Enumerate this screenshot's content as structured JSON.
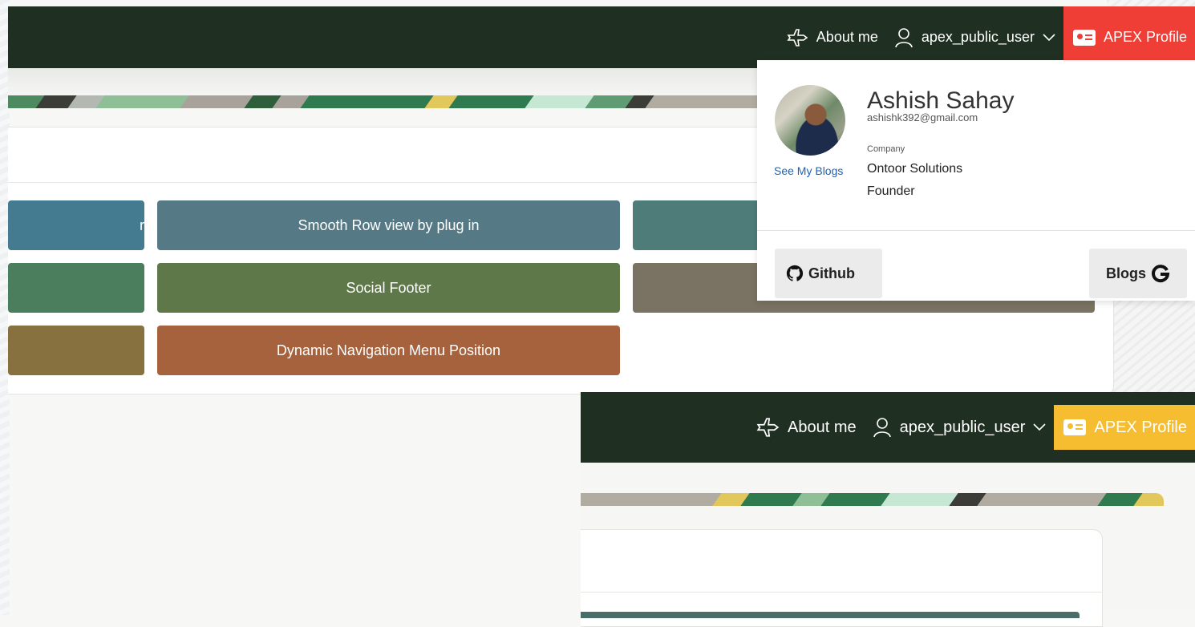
{
  "header": {
    "about_label": "About me",
    "user_label": "apex_public_user",
    "apex_profile_label": "APEX Profile",
    "apex_color_top": "#ef3e36",
    "apex_color_bottom": "#f5bd2f",
    "bar_color": "#1f2f22",
    "icons": {
      "about": "airplane-icon",
      "user": "user-icon",
      "chevron": "chevron-down-icon",
      "profile": "id-card-icon"
    }
  },
  "tiles": [
    {
      "label": "r",
      "color": "#447b90"
    },
    {
      "label": "Smooth Row view by plug in",
      "color": "#557a85"
    },
    {
      "label": "",
      "color": "#4e7d79"
    },
    {
      "label": "",
      "color": "#4b7e5c"
    },
    {
      "label": "Social Footer",
      "color": "#5f784a"
    },
    {
      "label": "",
      "color": "#7a7363"
    },
    {
      "label": "",
      "color": "#87713e"
    },
    {
      "label": "Dynamic Navigation Menu Position",
      "color": "#a6623c"
    }
  ],
  "profile": {
    "name": "Ashish Sahay",
    "email": "ashishk392@gmail.com",
    "company_label": "Company",
    "company": "Ontoor Solutions",
    "role": "Founder",
    "see_blogs_label": "See My Blogs",
    "github_label": "Github",
    "blogs_label": "Blogs"
  }
}
